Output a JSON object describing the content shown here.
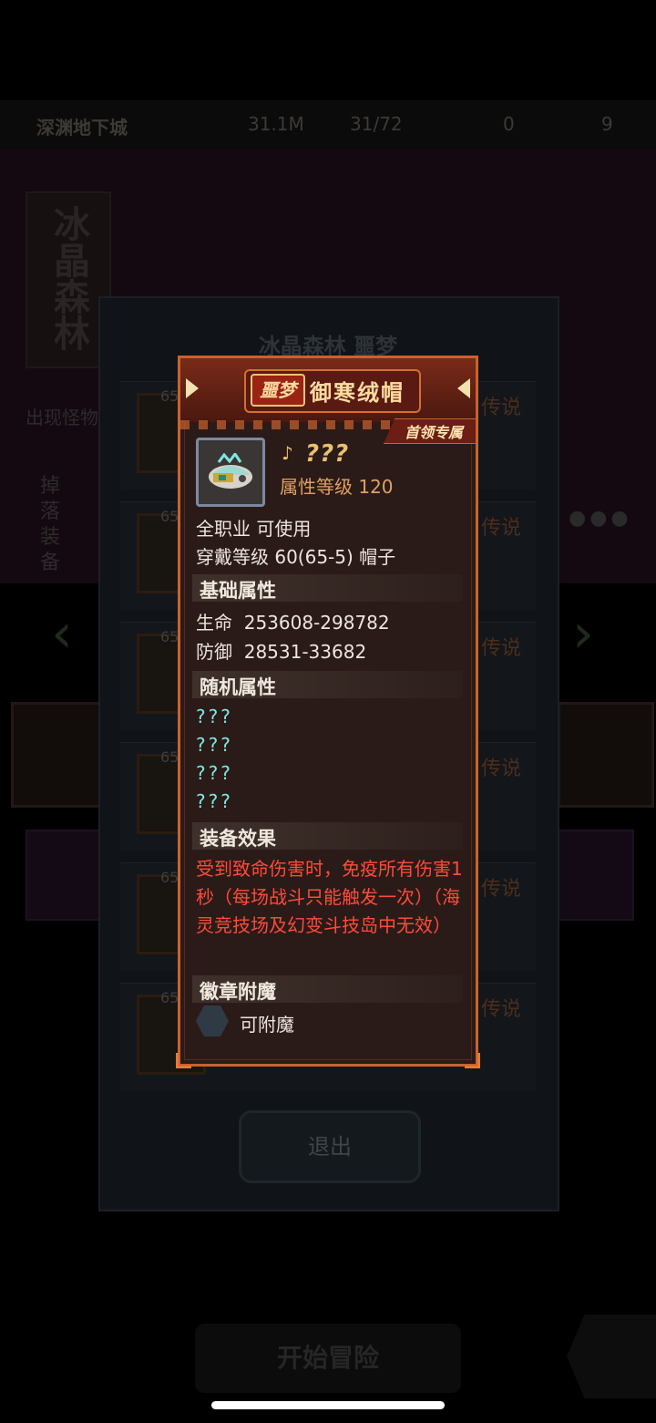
{
  "background": {
    "top_bar": {
      "dungeon_name": "深渊地下城",
      "gold": "31.1M",
      "stamina": "31/72",
      "tickets": "0",
      "keys": "9"
    },
    "side_banner": "冰晶森林",
    "left_labels": {
      "monsters": "出现怪物",
      "drops": "掉落装备"
    },
    "panel_title": "冰晶森林 噩梦",
    "list_rows": [
      {
        "level": "65",
        "rarity": "传说"
      },
      {
        "level": "65",
        "rarity": "传说"
      },
      {
        "level": "65",
        "rarity": "传说"
      },
      {
        "level": "65",
        "rarity": "传说"
      },
      {
        "level": "65",
        "rarity": "传说"
      },
      {
        "level": "65",
        "rarity": "传说"
      }
    ],
    "exit_label": "退出",
    "start_label": "开始冒险"
  },
  "tooltip": {
    "difficulty_badge": "噩梦",
    "item_name": "御寒绒帽",
    "tag": "首领专属",
    "unknown_name": "???",
    "attribute_level": "属性等级 120",
    "usable": "全职业 可使用",
    "wear_level": "穿戴等级 60(65-5) 帽子",
    "base_section": "基础属性",
    "hp": "生命  253608-298782",
    "defense": "防御  28531-33682",
    "random_section": "随机属性",
    "random_attrs": [
      "???",
      "???",
      "???",
      "???"
    ],
    "effect_section": "装备效果",
    "effect_text": "受到致命伤害时，免疫所有伤害1秒（每场战斗只能触发一次）（海灵竞技场及幻变斗技岛中无效）",
    "badge_section": "徽章附魔",
    "enchant_label": "可附魔"
  },
  "colors": {
    "card_border": "#c9622d",
    "card_bg": "#2a1b18",
    "effect_red": "#ff4b3a",
    "unknown_cyan": "#7fe7e0",
    "gold_text": "#e8c070"
  }
}
